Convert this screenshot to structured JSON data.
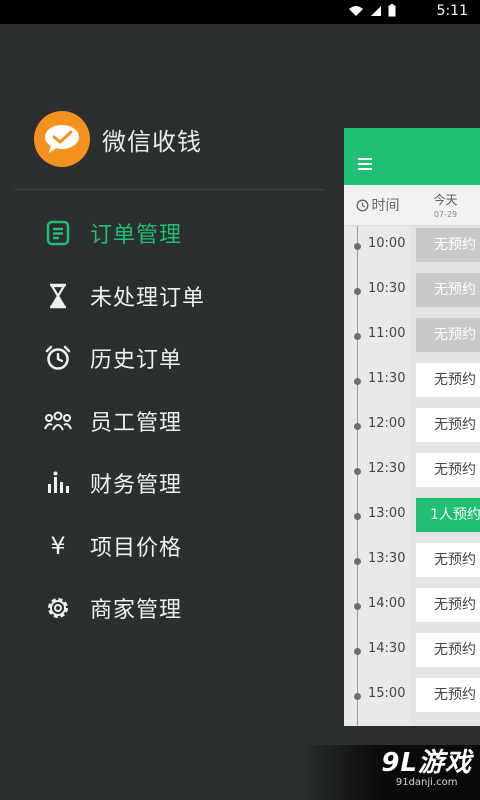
{
  "status_bar": {
    "time": "5:11",
    "icons": [
      "wifi-icon",
      "signal-icon",
      "battery-icon"
    ]
  },
  "app": {
    "name": "微信收钱",
    "logo_icon": "chat-bubble-icon",
    "accent": "#21bf73",
    "logo_color": "#f3921f"
  },
  "menu": [
    {
      "label": "订单管理",
      "icon": "document-list-icon",
      "active": true
    },
    {
      "label": "未处理订单",
      "icon": "hourglass-icon",
      "active": false
    },
    {
      "label": "历史订单",
      "icon": "alarm-clock-icon",
      "active": false
    },
    {
      "label": "员工管理",
      "icon": "people-icon",
      "active": false
    },
    {
      "label": "财务管理",
      "icon": "bar-chart-icon",
      "active": false
    },
    {
      "label": "项目价格",
      "icon": "yen-icon",
      "glyph": "¥",
      "active": false
    },
    {
      "label": "商家管理",
      "icon": "gear-icon",
      "active": false
    }
  ],
  "schedule": {
    "time_header": "时间",
    "day_label": "今天",
    "day_date": "07-29",
    "slots": [
      {
        "time": "10:00",
        "label": "无预约",
        "state": "past"
      },
      {
        "time": "10:30",
        "label": "无预约",
        "state": "past"
      },
      {
        "time": "11:00",
        "label": "无预约",
        "state": "past"
      },
      {
        "time": "11:30",
        "label": "无预约",
        "state": "open"
      },
      {
        "time": "12:00",
        "label": "无预约",
        "state": "open"
      },
      {
        "time": "12:30",
        "label": "无预约",
        "state": "open"
      },
      {
        "time": "13:00",
        "label": "1人预约",
        "state": "booked"
      },
      {
        "time": "13:30",
        "label": "无预约",
        "state": "open"
      },
      {
        "time": "14:00",
        "label": "无预约",
        "state": "open"
      },
      {
        "time": "14:30",
        "label": "无预约",
        "state": "open"
      },
      {
        "time": "15:00",
        "label": "无预约",
        "state": "open"
      }
    ]
  },
  "watermark": {
    "brand": "9L游戏",
    "url": "91danji.com"
  }
}
